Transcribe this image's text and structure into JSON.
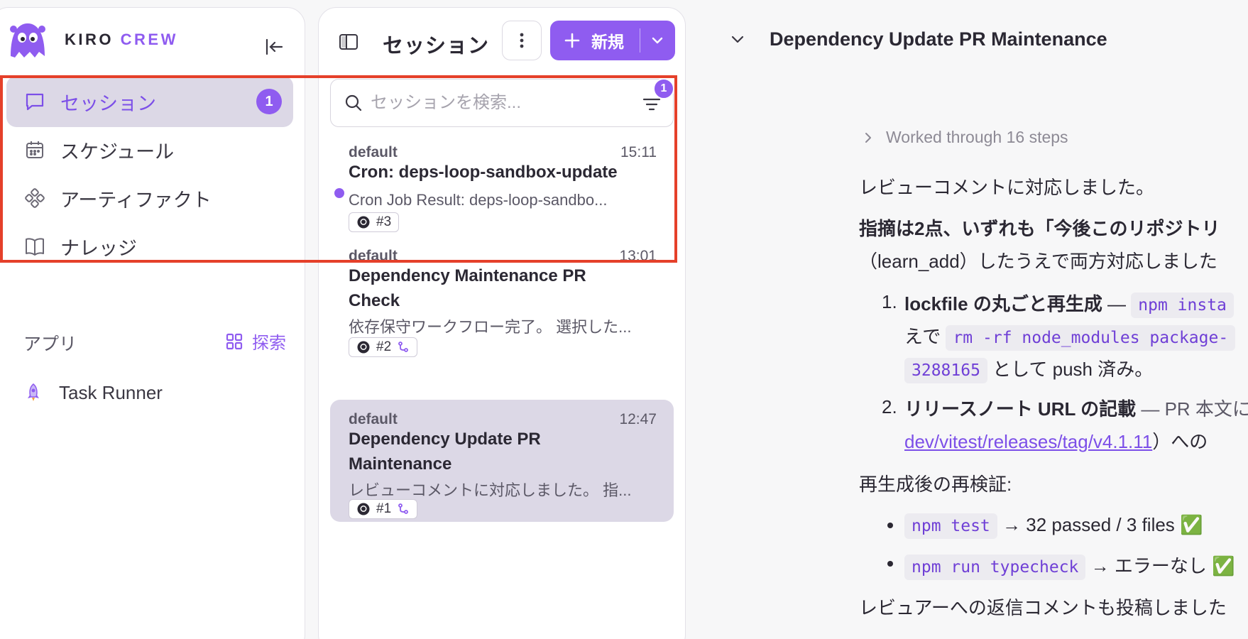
{
  "brand": {
    "kiro": "KIRO",
    "crew": "CREW",
    "logo_icon": "mascot-logo",
    "accent": "#8f5cf0"
  },
  "sidebar": {
    "collapse_icon": "collapse-left-icon",
    "items": [
      {
        "label": "セッション",
        "icon": "chat-icon",
        "badge": "1",
        "active": true
      },
      {
        "label": "スケジュール",
        "icon": "calendar-icon"
      },
      {
        "label": "アーティファクト",
        "icon": "artifact-icon"
      },
      {
        "label": "ナレッジ",
        "icon": "book-icon"
      }
    ],
    "apps_label": "アプリ",
    "explore_label": "探索",
    "app_items": [
      {
        "label": "Task Runner",
        "icon": "rocket-icon"
      }
    ]
  },
  "sessions": {
    "title": "セッション",
    "new_label": "新規",
    "search": {
      "placeholder": "セッションを検索...",
      "value": ""
    },
    "filter_badge": "1",
    "cards": [
      {
        "workspace": "default",
        "time": "15:11",
        "title": "Cron: deps-loop-sandbox-update",
        "snippet": "Cron Job Result: deps-loop-sandbo...",
        "tag": "#3",
        "unread": true
      },
      {
        "workspace": "default",
        "time": "13:01",
        "title": "Dependency Maintenance PR Check",
        "snippet": "依存保守ワークフロー完了。 選択した...",
        "tag": "#2",
        "branch": true
      },
      {
        "workspace": "default",
        "time": "12:47",
        "title": "Dependency Update PR Maintenance",
        "snippet": "レビューコメントに対応しました。 指...",
        "tag": "#1",
        "branch": true,
        "selected": true
      }
    ]
  },
  "conversation": {
    "title": "Dependency Update PR Maintenance",
    "steps_label": "Worked through 16 steps",
    "p1": "レビューコメントに対応しました。",
    "p2a": "指摘は2点、いずれも「今後このリポジトリ",
    "p2b": "（learn_add）したうえで両方対応しました",
    "item1_num": "1.",
    "item1_bold": "lockfile の丸ごと再生成",
    "item1_dash": " — ",
    "item1_code": "npm insta",
    "item1_line2_a": "えで ",
    "item1_line2_code": "rm -rf node_modules package-",
    "item1_line3_code": "3288165",
    "item1_line3_b": " として push 済み。",
    "item2_num": "2.",
    "item2_bold": "リリースノート URL の記載",
    "item2_rest": " — PR 本文に",
    "item2_link": "dev/vitest/releases/tag/v4.1.11",
    "item2_after": "）への",
    "p3": "再生成後の再検証:",
    "b1_code": "npm test",
    "b1_rest": " → 32 passed / 3 files ✅",
    "b2_code": "npm run typecheck",
    "b2_rest": " → エラーなし ✅",
    "p4": "レビュアーへの返信コメントも投稿しました"
  }
}
